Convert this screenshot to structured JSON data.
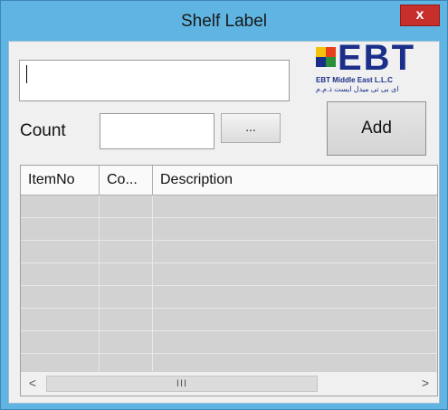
{
  "window": {
    "title": "Shelf Label",
    "close_glyph": "x"
  },
  "logo": {
    "text": "EBT",
    "subtitle": "EBT Middle East L.L.C",
    "arabic": "ای بی تی میدل ایست ذ.م.م",
    "colors": [
      "#f4c20d",
      "#e8401c",
      "#1b2f8a",
      "#2a8f3a"
    ]
  },
  "form": {
    "item_input_value": "",
    "count_label": "Count",
    "count_value": "",
    "browse_label": "...",
    "add_label": "Add"
  },
  "grid": {
    "columns": [
      "ItemNo",
      "Co...",
      "Description"
    ],
    "rows": [
      [
        "",
        "",
        ""
      ],
      [
        "",
        "",
        ""
      ],
      [
        "",
        "",
        ""
      ],
      [
        "",
        "",
        ""
      ],
      [
        "",
        "",
        ""
      ],
      [
        "",
        "",
        ""
      ],
      [
        "",
        "",
        ""
      ],
      [
        "",
        "",
        ""
      ]
    ],
    "scroll_left_glyph": "<",
    "scroll_right_glyph": ">",
    "scroll_thumb_grip": "III"
  }
}
